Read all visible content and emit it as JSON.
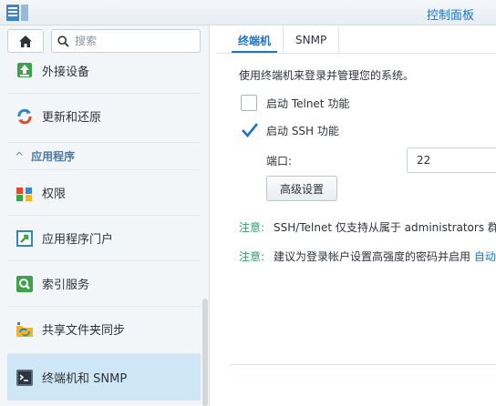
{
  "window": {
    "title": "控制面板"
  },
  "search": {
    "placeholder": "搜索"
  },
  "sidebar": {
    "items_top": [
      {
        "label": "外接设备",
        "icon": "external-device-icon"
      },
      {
        "label": "更新和还原",
        "icon": "update-restore-icon"
      }
    ],
    "section": {
      "label": "应用程序",
      "chevron": "^"
    },
    "items": [
      {
        "label": "权限",
        "icon": "privileges-icon"
      },
      {
        "label": "应用程序门户",
        "icon": "app-portal-icon"
      },
      {
        "label": "索引服务",
        "icon": "indexing-service-icon"
      },
      {
        "label": "共享文件夹同步",
        "icon": "shared-folder-sync-icon"
      },
      {
        "label": "终端机和 SNMP",
        "icon": "terminal-snmp-icon",
        "active": true
      }
    ]
  },
  "tabs": [
    {
      "label": "终端机",
      "active": true
    },
    {
      "label": "SNMP",
      "active": false
    }
  ],
  "main": {
    "description": "使用终端机来登录并管理您的系统。",
    "telnet": {
      "label": "启动 Telnet 功能",
      "checked": false
    },
    "ssh": {
      "label": "启动 SSH 功能",
      "checked": true
    },
    "port": {
      "label": "端口:",
      "value": "22"
    },
    "advanced_button": "高级设置",
    "note1": {
      "label": "注意:",
      "text": "SSH/Telnet 仅支持从属于 administrators 群"
    },
    "note2": {
      "label": "注意:",
      "text": "建议为登录帐户设置高强度的密码并启用",
      "link": "自动"
    }
  },
  "colors": {
    "accent": "#1f74c6",
    "note_label": "#2f9a6a",
    "active_row": "#cfe6f7"
  }
}
